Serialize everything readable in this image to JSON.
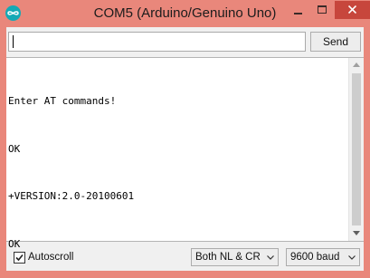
{
  "window": {
    "title": "COM5 (Arduino/Genuino Uno)"
  },
  "input": {
    "value": "",
    "placeholder": ""
  },
  "toolbar": {
    "send_label": "Send"
  },
  "output": {
    "lines": [
      "Enter AT commands!",
      "OK",
      "+VERSION:2.0-20100601",
      "OK"
    ]
  },
  "footer": {
    "autoscroll_label": "Autoscroll",
    "autoscroll_checked": true,
    "line_ending": "Both NL & CR",
    "baud_rate": "9600 baud"
  },
  "icons": {
    "app": "arduino-icon",
    "minimize": "minimize-icon",
    "maximize": "maximize-icon",
    "close": "close-icon",
    "scroll_up": "arrow-up-icon",
    "scroll_down": "arrow-down-icon",
    "dropdown": "chevron-down-icon",
    "check": "checkmark-icon"
  },
  "colors": {
    "window_frame": "#e9877b",
    "close_button": "#c7463c",
    "arduino_teal": "#15a9b5"
  }
}
